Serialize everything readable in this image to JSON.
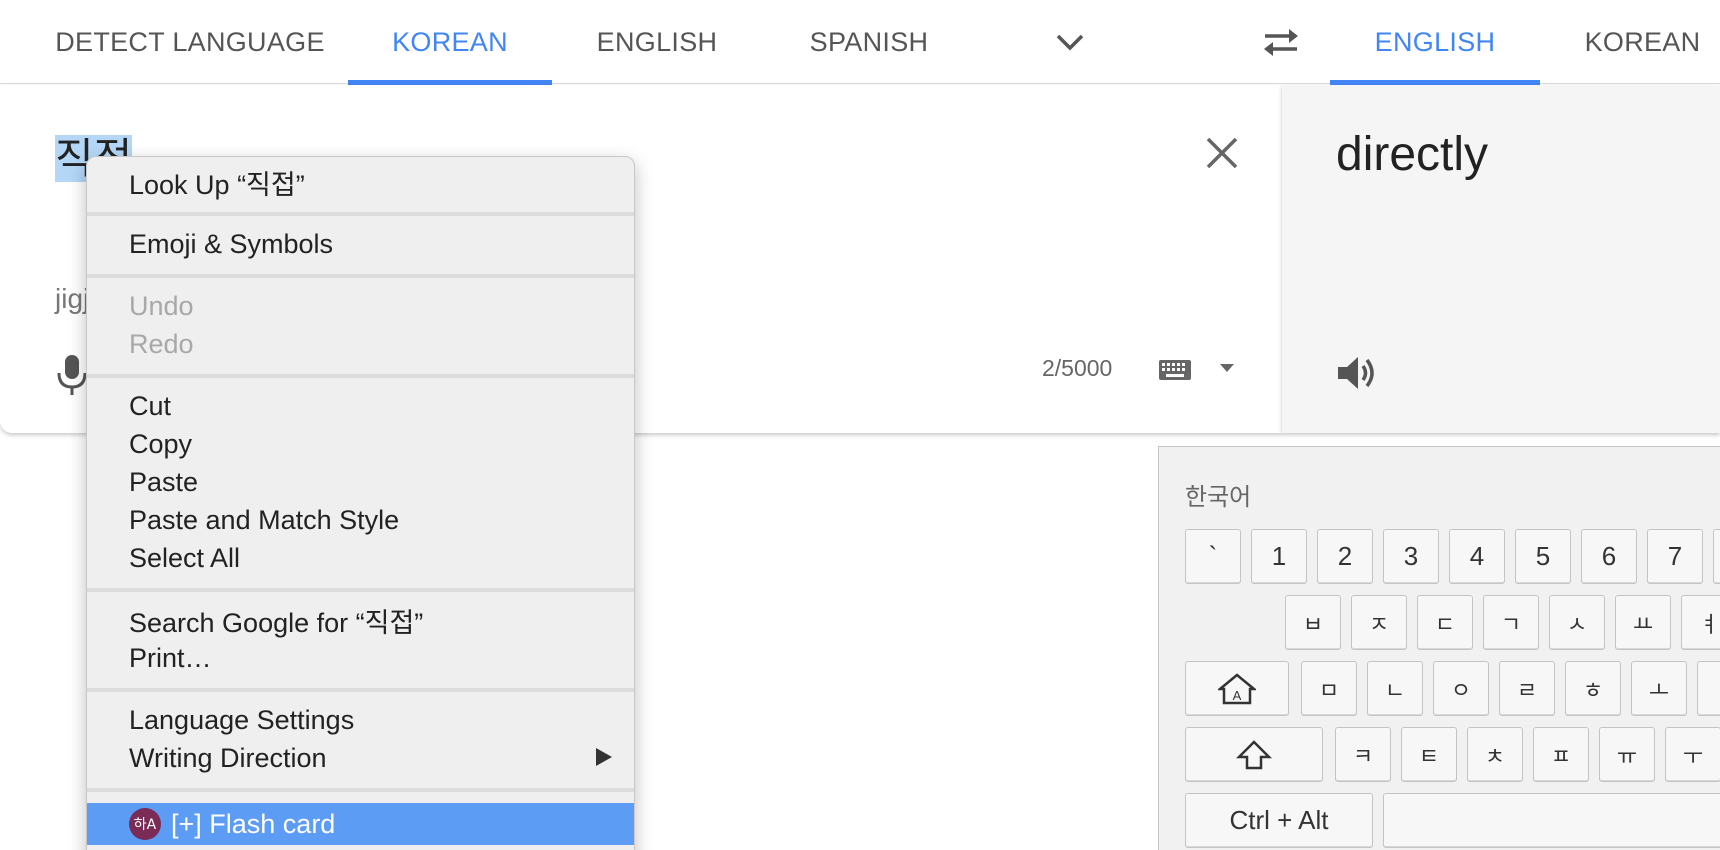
{
  "language_bar": {
    "source_tabs": [
      "DETECT LANGUAGE",
      "KOREAN",
      "ENGLISH",
      "SPANISH"
    ],
    "active_source": "KOREAN",
    "target_tabs": [
      "ENGLISH",
      "KOREAN"
    ],
    "active_target": "ENGLISH",
    "more_icon": "chevron-down-icon",
    "swap_icon": "swap-arrows-icon"
  },
  "source": {
    "text": "직접",
    "romanization": "jigjeob",
    "char_count": "2/5000"
  },
  "target": {
    "text": "directly"
  },
  "context_menu": {
    "look_up": "Look Up “직접”",
    "emoji": "Emoji & Symbols",
    "undo": "Undo",
    "redo": "Redo",
    "cut": "Cut",
    "copy": "Copy",
    "paste": "Paste",
    "paste_match": "Paste and Match Style",
    "select_all": "Select All",
    "search_google": "Search Google for “직접”",
    "print": "Print…",
    "language_settings": "Language Settings",
    "writing_direction": "Writing Direction",
    "flash_card": "[+] Flash card",
    "flash_badge": "하A"
  },
  "keyboard": {
    "title": "한국어",
    "row1": [
      "`",
      "1",
      "2",
      "3",
      "4",
      "5",
      "6",
      "7"
    ],
    "row2": [
      "ㅂ",
      "ㅈ",
      "ㄷ",
      "ㄱ",
      "ㅅ",
      "ㅛ",
      "ㅕ"
    ],
    "row3": [
      "ㅁ",
      "ㄴ",
      "ㅇ",
      "ㄹ",
      "ㅎ",
      "ㅗ"
    ],
    "row4": [
      "ㅋ",
      "ㅌ",
      "ㅊ",
      "ㅍ",
      "ㅠ",
      "ㅜ"
    ],
    "ctrl_alt": "Ctrl + Alt"
  },
  "colors": {
    "accent": "#4285f4",
    "menu_highlight": "#5d9cf5",
    "selection": "#b4d7f7"
  }
}
